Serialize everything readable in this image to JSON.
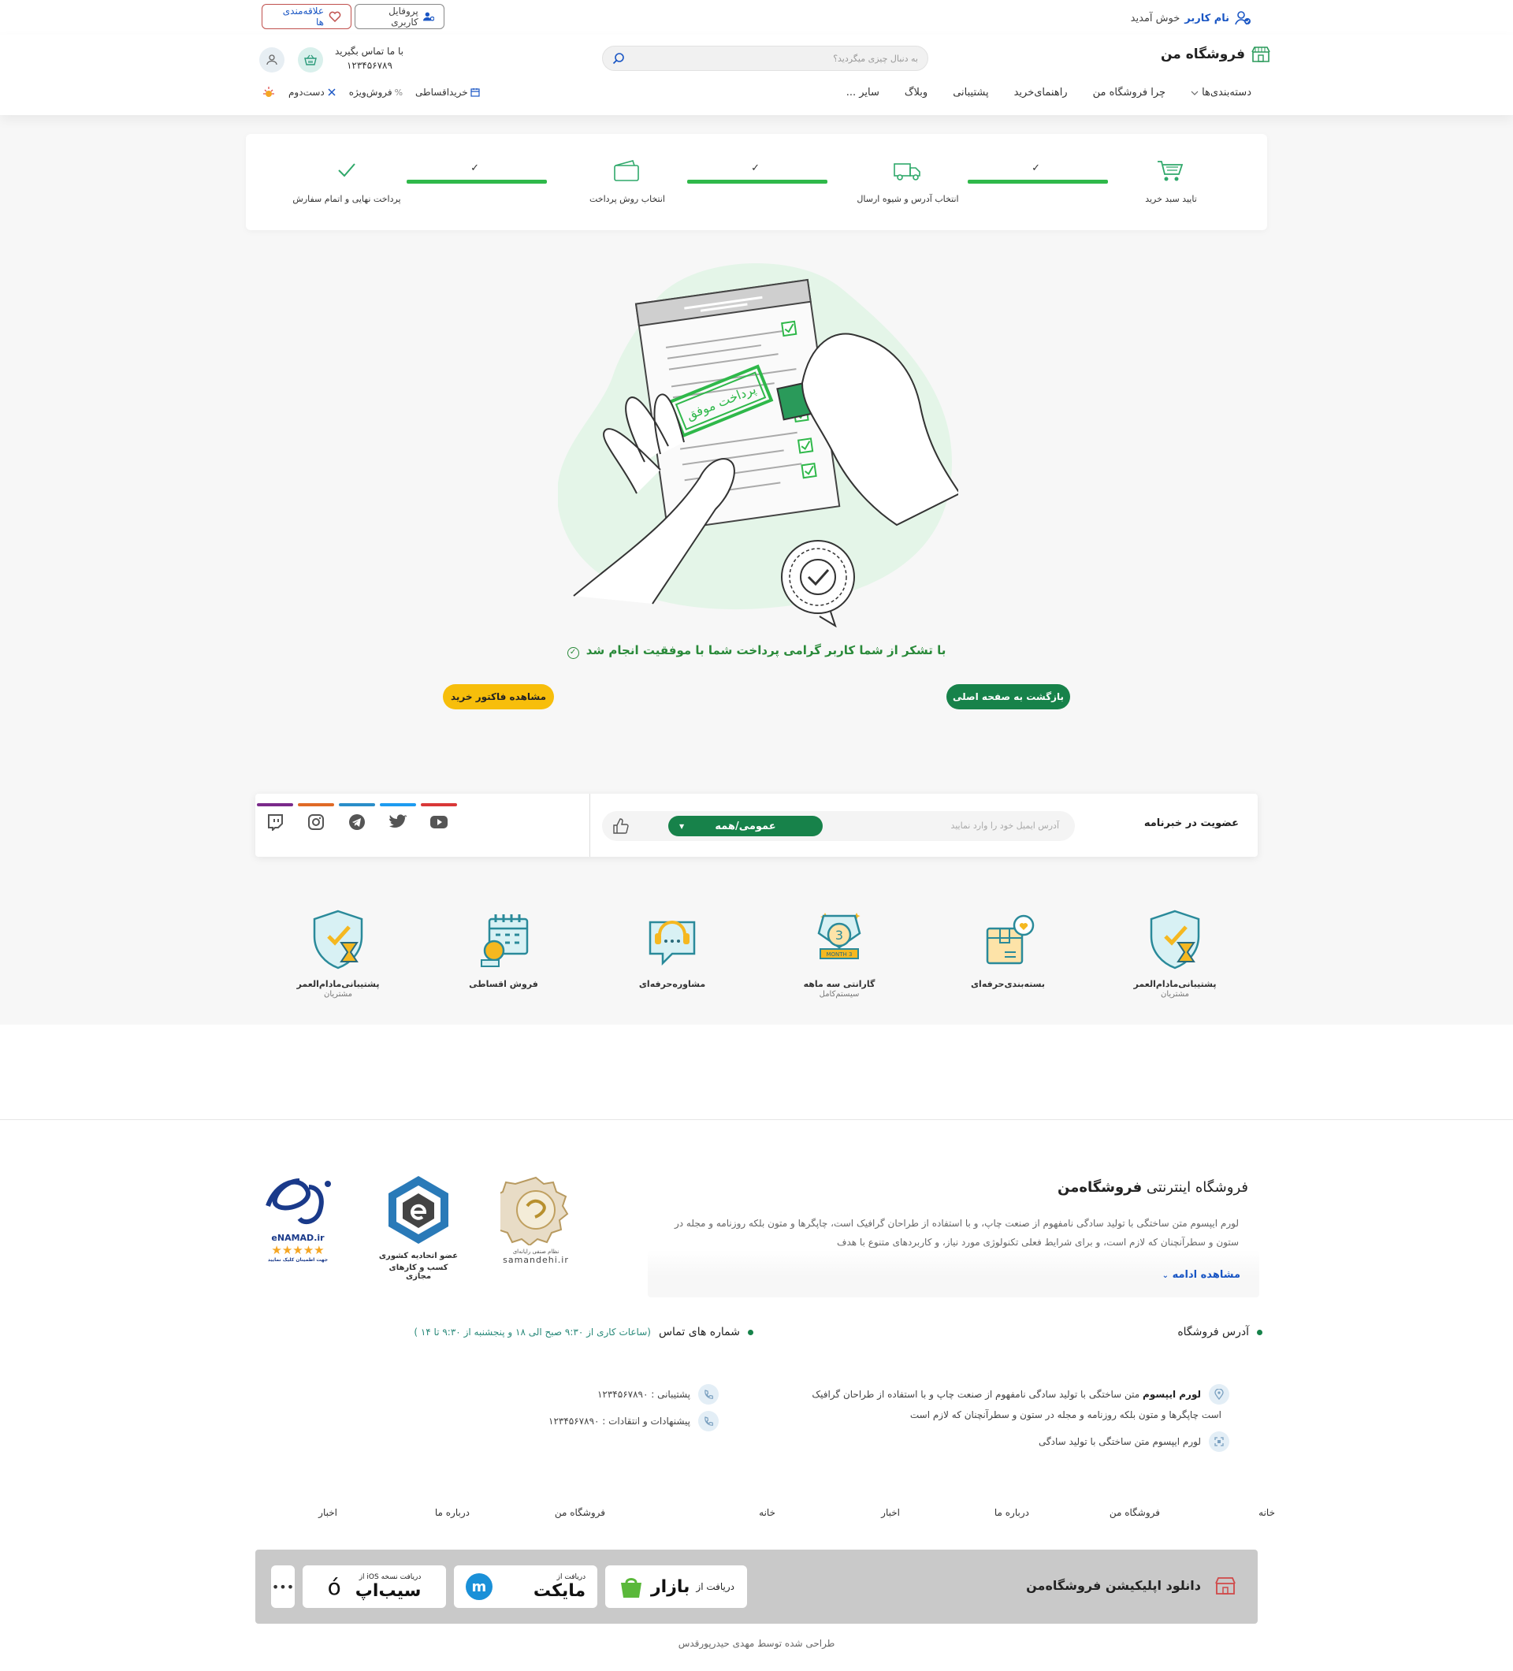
{
  "topbar": {
    "username": "نام کاربر",
    "welcome": "خوش آمدید",
    "favorites_label": "علاقه‌مندی ها",
    "profile_label": "پروفایل کاربری"
  },
  "header": {
    "logo_text": "فروشگاه من",
    "search_placeholder": "به دنبال چیزی میگردید؟",
    "contact_title": "با ما تماس بگیرید",
    "contact_phone": "۱۲۳۴۵۶۷۸۹",
    "nav": [
      "دسته‌بندی‌ها",
      "چرا فروشگاه من",
      "راهنمای‌خرید",
      "پشتیبانی",
      "وبلاگ",
      "سایر ..."
    ],
    "secondary_nav": [
      "خریداقساطی",
      "فروش‌ویژه",
      "دست‌دوم"
    ]
  },
  "steps": [
    "تایید سبد خرید",
    "انتخاب آدرس و شیوه ارسال",
    "انتخاب روش پرداخت",
    "پرداخت نهایی و اتمام سفارش"
  ],
  "illustration": {
    "stamp_text": "پرداخت موفق"
  },
  "success": {
    "message": "با تشکر از شما کاربر گرامی پرداخت شما با موفقیت انجام شد",
    "home_button": "بازگشت به صفحه اصلی",
    "invoice_button": "مشاهده فاکتور خرید"
  },
  "newsletter": {
    "title": "عضویت در خبرنامه",
    "email_placeholder": "آدرس ایمیل خود را وارد نمایید",
    "category": "عمومی/همه",
    "social": [
      {
        "name": "youtube-icon",
        "color": "#d93838"
      },
      {
        "name": "twitter-icon",
        "color": "#1d9bf0"
      },
      {
        "name": "telegram-icon",
        "color": "#2a8ec9"
      },
      {
        "name": "instagram-icon",
        "color": "#e06a26"
      },
      {
        "name": "twitch-icon",
        "color": "#7a2a8a"
      }
    ]
  },
  "features": [
    {
      "label": "پشتیبانی‌مادام‌العمر",
      "sub": "مشتریان"
    },
    {
      "label": "بسته‌بندی‌حرفه‌ای",
      "sub": ""
    },
    {
      "label": "گارانتی سه ماهه",
      "sub": "سیستم‌کامل",
      "badge": "3 MONTH",
      "number": "3"
    },
    {
      "label": "مشاوره‌حرفه‌ای",
      "sub": ""
    },
    {
      "label": "فروش اقساطی",
      "sub": ""
    },
    {
      "label": "پشتیبانی‌مادام‌العمر",
      "sub": "مشتریان"
    }
  ],
  "footer": {
    "store_title_prefix": "فروشگاه اینترنتی",
    "store_title_bold": "فروشگاه‌من",
    "store_text": "لورم ایپسوم متن ساختگی با تولید سادگی نامفهوم از صنعت چاپ، و با استفاده از طراحان گرافیک است، چاپگرها و متون بلکه روزنامه و مجله در ستون و سطرآنچنان که لازم است، و برای شرایط فعلی تکنولوژی مورد نیاز، و کاربردهای متنوع با هدف",
    "read_more": "مشاهده ادامه",
    "badges": [
      {
        "name": "samandehi",
        "caption": "samandehi.ir",
        "top": "نظام صنفی رایانه‌ای"
      },
      {
        "name": "etehadie",
        "line1": "عضو اتحادیه کشوری",
        "line2": "کسب و کارهای مجازی"
      },
      {
        "name": "enamad",
        "caption": "eNAMAD.ir",
        "stars": 5,
        "sub": "جهت اطمینان کلیک نمایید"
      }
    ],
    "address_title": "آدرس فروشگاه",
    "address_bold": "لورم ایپسوم",
    "address_line1": "متن ساختگی با تولید سادگی نامفهوم از صنعت چاپ و با استفاده از طراحان گرافیک",
    "address_line2": "است چاپگرها و متون بلکه روزنامه و مجله در ستون و سطرآنچنان که لازم است",
    "address_line3": "لورم ایپسوم متن ساختگی با تولید سادگی",
    "phones_title": "شماره های تماس",
    "phones_hours": "(ساعات کاری از ۹:۳۰ صبح الی ۱۸ و پنجشنبه از ۹:۳۰ تا ۱۴ )",
    "support_phone": "پشتیبانی : ۱۲۳۴۵۶۷۸۹۰",
    "feedback_phone": "پیشنهادات و انتقادات : ۱۲۳۴۵۶۷۸۹۰",
    "links": [
      "خانه",
      "فروشگاه من",
      "درباره ما",
      "اخبار",
      "خانه",
      "فروشگاه من",
      "درباره ما",
      "اخبار"
    ],
    "app_title": "دانلود اپلیکیشن فروشگاه‌من",
    "bazaar_prefix": "دریافت از",
    "bazaar_name": "بازار",
    "myket_prefix": "دریافت از",
    "myket_name": "مایکت",
    "sibapp_prefix": "دریافت نسخه iOS از",
    "sibapp_name": "سیب‌اپ",
    "more_apps": "•••",
    "credit": "طراحی شده توسط مهدی حیدرپورقدس"
  },
  "colors": {
    "primary": "#17824a",
    "accent": "#f7be0b",
    "link": "#1a56c4",
    "progress": "#2fb84a"
  }
}
